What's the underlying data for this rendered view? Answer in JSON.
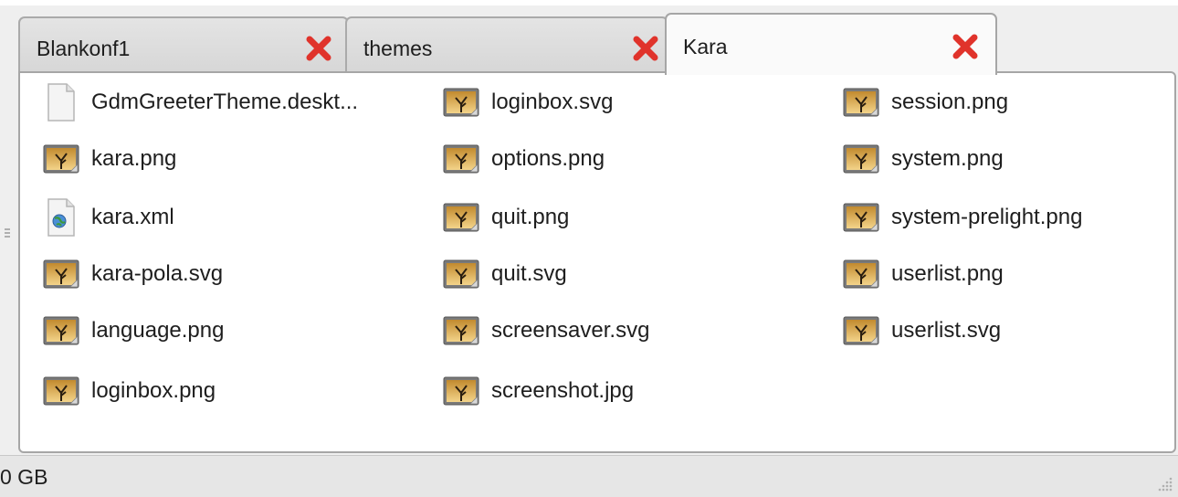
{
  "tabs": [
    {
      "label": "Blankonf1",
      "active": false,
      "close_icon": "close-x-icon"
    },
    {
      "label": "themes",
      "active": false,
      "close_icon": "close-x-icon"
    },
    {
      "label": "Kara",
      "active": true,
      "close_icon": "close-x-icon"
    }
  ],
  "files": {
    "columns": [
      [
        {
          "name": "GdmGreeterTheme.deskt...",
          "icon": "document-icon"
        },
        {
          "name": "kara.png",
          "icon": "image-icon"
        },
        {
          "name": "kara.xml",
          "icon": "xml-globe-icon"
        },
        {
          "name": "kara-pola.svg",
          "icon": "image-icon"
        },
        {
          "name": "language.png",
          "icon": "image-icon"
        },
        {
          "name": "loginbox.png",
          "icon": "image-icon"
        }
      ],
      [
        {
          "name": "loginbox.svg",
          "icon": "image-icon"
        },
        {
          "name": "options.png",
          "icon": "image-icon"
        },
        {
          "name": "quit.png",
          "icon": "image-icon"
        },
        {
          "name": "quit.svg",
          "icon": "image-icon"
        },
        {
          "name": "screensaver.svg",
          "icon": "image-icon"
        },
        {
          "name": "screenshot.jpg",
          "icon": "image-icon"
        }
      ],
      [
        {
          "name": "session.png",
          "icon": "image-icon"
        },
        {
          "name": "system.png",
          "icon": "image-icon"
        },
        {
          "name": "system-prelight.png",
          "icon": "image-icon"
        },
        {
          "name": "userlist.png",
          "icon": "image-icon"
        },
        {
          "name": "userlist.svg",
          "icon": "image-icon"
        }
      ]
    ]
  },
  "statusbar": {
    "text": "0 GB"
  },
  "colors": {
    "close": "#e0332b",
    "tab_bg": "#dcdcdc",
    "active_tab_bg": "#fafafa",
    "statusbar_bg": "#e6e6e6"
  }
}
